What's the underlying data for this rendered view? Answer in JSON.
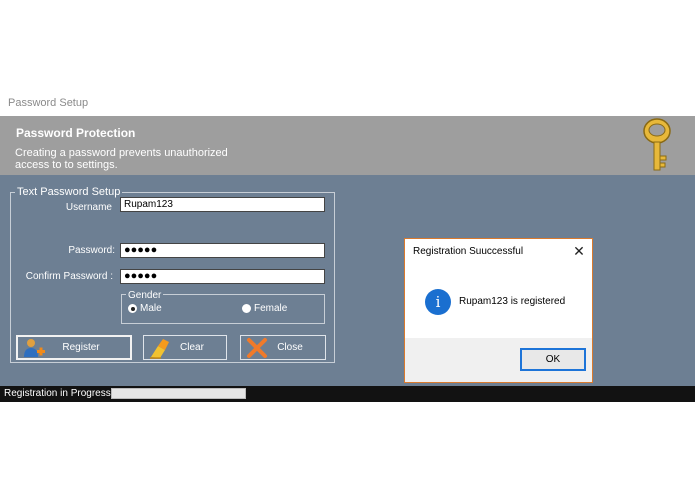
{
  "window": {
    "title": "Password Setup",
    "banner_title": "Password Protection",
    "banner_description": "Creating a password prevents unauthorized access to to settings.",
    "banner_icon": "key-icon",
    "colors": {
      "banner": "#9e9e9e",
      "client": "#6d7f93",
      "statusbar": "#121212"
    }
  },
  "form": {
    "group_title": "Text Password Setup",
    "username_label": "Username",
    "username_value": "Rupam123",
    "password_label": "Password:",
    "password_value": "●●●●●",
    "confirm_label": "Confirm Password :",
    "confirm_value": "●●●●●",
    "gender_title": "Gender",
    "gender_options": [
      "Male",
      "Female"
    ],
    "gender_selected": "Male"
  },
  "buttons": {
    "register": {
      "label": "Register",
      "icon": "add-user-icon"
    },
    "clear": {
      "label": "Clear",
      "icon": "broom-icon"
    },
    "close": {
      "label": "Close",
      "icon": "x-icon"
    }
  },
  "status": {
    "text": "Registration in Progress",
    "progress": 0
  },
  "dialog": {
    "title": "Registration Suuccessful",
    "close_glyph": "✕",
    "icon": "info-icon",
    "icon_glyph": "i",
    "message": "Rupam123 is registered",
    "ok_label": "OK",
    "accent": "#1d74d8"
  }
}
